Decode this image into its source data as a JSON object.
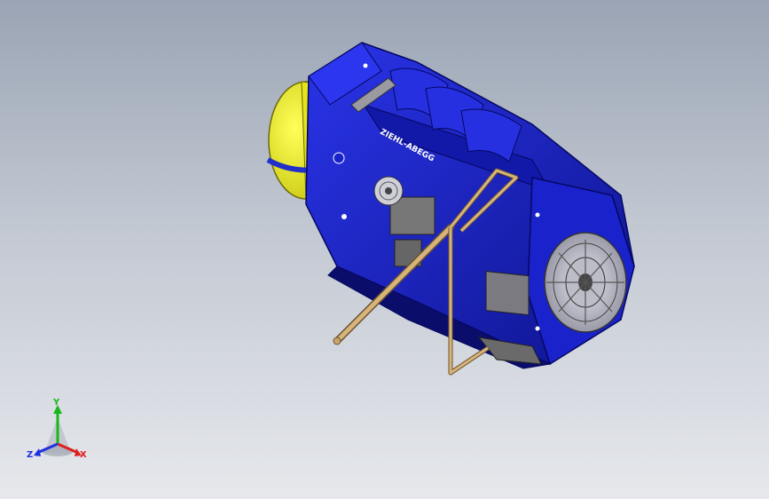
{
  "viewport": {
    "colors": {
      "bg_top": "#9aa4b4",
      "bg_bottom": "#e6e8ec",
      "housing_blue": "#1a22cc",
      "housing_dark": "#0d128a",
      "motor_yellow": "#f2f21c",
      "rod_tan": "#c8a46a",
      "metal_grey": "#8a8a8a"
    }
  },
  "model": {
    "brand_text": "ZIEHL-ABEGG"
  },
  "triad": {
    "x_label": "X",
    "y_label": "Y",
    "z_label": "Z",
    "x_color": "#e02020",
    "y_color": "#18b818",
    "z_color": "#2030e0"
  }
}
